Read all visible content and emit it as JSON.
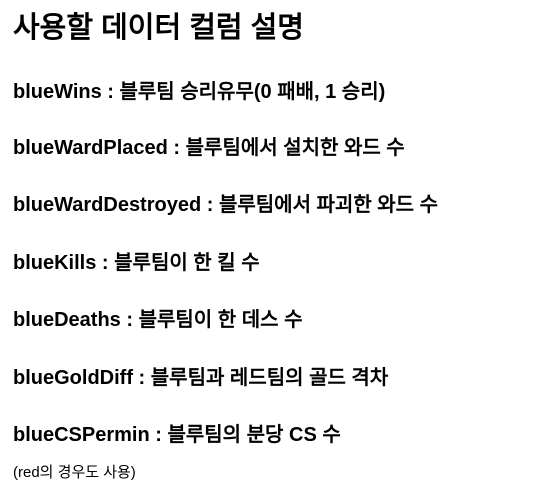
{
  "title": "사용할 데이터 컬럼 설명",
  "items": [
    {
      "name": "blueWins",
      "desc": "블루팀 승리유무(0 패배, 1 승리)"
    },
    {
      "name": "blueWardPlaced",
      "desc": "블루팀에서 설치한 와드 수"
    },
    {
      "name": "blueWardDestroyed",
      "desc": "블루팀에서 파괴한 와드 수"
    },
    {
      "name": "blueKills",
      "desc": "블루팀이 한 킬 수"
    },
    {
      "name": "blueDeaths",
      "desc": "블루팀이 한 데스 수"
    },
    {
      "name": "blueGoldDiff",
      "desc": "블루팀과 레드팀의 골드 격차"
    },
    {
      "name": "blueCSPermin",
      "desc": "블루팀의 분당 CS 수"
    }
  ],
  "separator": " : ",
  "note": "(red의 경우도 사용)"
}
